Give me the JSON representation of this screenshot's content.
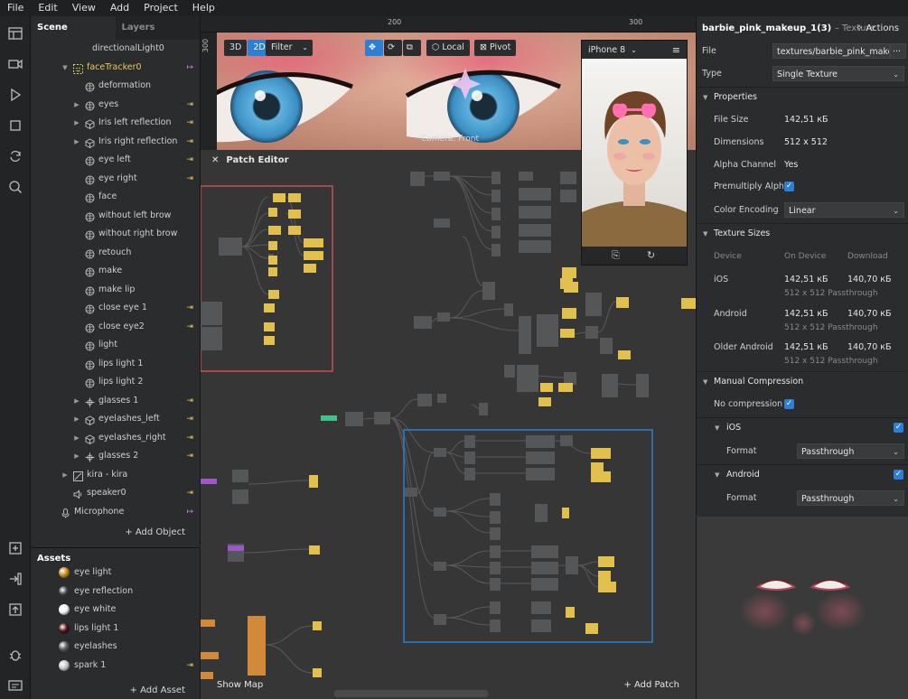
{
  "menu": [
    "File",
    "Edit",
    "View",
    "Add",
    "Project",
    "Help"
  ],
  "scene": {
    "tabs": [
      "Scene",
      "Layers"
    ],
    "items": [
      {
        "label": "directionalLight0",
        "indent": 0,
        "arrow": "",
        "icon": "none",
        "action": ""
      },
      {
        "label": "faceTracker0",
        "indent": 1,
        "arrow": "open",
        "icon": "face-tracker",
        "action": "out",
        "selected": true
      },
      {
        "label": "deformation",
        "indent": 2,
        "arrow": "",
        "icon": "mesh",
        "action": ""
      },
      {
        "label": "eyes",
        "indent": 2,
        "arrow": "closed",
        "icon": "mesh",
        "action": "in"
      },
      {
        "label": "Iris left  reflection",
        "indent": 2,
        "arrow": "closed",
        "icon": "cube",
        "action": "in"
      },
      {
        "label": "Iris right reflection",
        "indent": 2,
        "arrow": "closed",
        "icon": "cube",
        "action": "in"
      },
      {
        "label": "eye left",
        "indent": 2,
        "arrow": "",
        "icon": "mesh",
        "action": "in"
      },
      {
        "label": "eye right",
        "indent": 2,
        "arrow": "",
        "icon": "mesh",
        "action": "in"
      },
      {
        "label": "face",
        "indent": 2,
        "arrow": "",
        "icon": "mesh",
        "action": ""
      },
      {
        "label": "without left brow",
        "indent": 2,
        "arrow": "",
        "icon": "mesh",
        "action": ""
      },
      {
        "label": "without right brow",
        "indent": 2,
        "arrow": "",
        "icon": "mesh",
        "action": ""
      },
      {
        "label": "retouch",
        "indent": 2,
        "arrow": "",
        "icon": "mesh",
        "action": ""
      },
      {
        "label": "make",
        "indent": 2,
        "arrow": "",
        "icon": "mesh",
        "action": ""
      },
      {
        "label": "make lip",
        "indent": 2,
        "arrow": "",
        "icon": "mesh",
        "action": ""
      },
      {
        "label": "close eye 1",
        "indent": 2,
        "arrow": "",
        "icon": "mesh",
        "action": "in"
      },
      {
        "label": "close eye2",
        "indent": 2,
        "arrow": "",
        "icon": "mesh",
        "action": "in"
      },
      {
        "label": "light",
        "indent": 2,
        "arrow": "",
        "icon": "mesh",
        "action": ""
      },
      {
        "label": "lips light 1",
        "indent": 2,
        "arrow": "",
        "icon": "mesh",
        "action": ""
      },
      {
        "label": "lips light 2",
        "indent": 2,
        "arrow": "",
        "icon": "mesh",
        "action": ""
      },
      {
        "label": "glasses 1",
        "indent": 2,
        "arrow": "closed",
        "icon": "null-object",
        "action": "in"
      },
      {
        "label": "eyelashes_left",
        "indent": 2,
        "arrow": "closed",
        "icon": "cube",
        "action": "in"
      },
      {
        "label": "eyelashes_right",
        "indent": 2,
        "arrow": "closed",
        "icon": "cube",
        "action": "in"
      },
      {
        "label": "glasses 2",
        "indent": 2,
        "arrow": "closed",
        "icon": "null-object",
        "action": "in"
      },
      {
        "label": "kira - kira",
        "indent": 1,
        "arrow": "closed",
        "icon": "particle",
        "action": ""
      },
      {
        "label": "speaker0",
        "indent": 1,
        "arrow": "",
        "icon": "speaker",
        "action": "in"
      },
      {
        "label": "Microphone",
        "indent": 0,
        "arrow": "",
        "icon": "microphone",
        "action": "out-pink"
      }
    ],
    "add_object": "+ Add Object"
  },
  "assets": {
    "header": "Assets",
    "items": [
      {
        "label": "eye light",
        "color": "#c88a1c",
        "action": ""
      },
      {
        "label": "eye reflection",
        "color": "#3c3c3c",
        "action": ""
      },
      {
        "label": "eye white",
        "color": "#f2f2f2",
        "action": ""
      },
      {
        "label": "lips light 1",
        "color": "#4a1010",
        "action": ""
      },
      {
        "label": "eyelashes",
        "color": "#5a5a5a",
        "action": ""
      },
      {
        "label": "spark 1",
        "color": "#c8c8c8",
        "action": "in"
      }
    ],
    "add_asset": "+ Add Asset"
  },
  "viewport": {
    "ruler_h": [
      "200",
      "300"
    ],
    "ruler_v": "300",
    "mode_3d": "3D",
    "mode_2d": "2D",
    "filter": "Filter",
    "local": "Local",
    "pivot": "Pivot",
    "camera": "Camera: Front"
  },
  "preview": {
    "device": "iPhone 8"
  },
  "patch_editor": {
    "title": "Patch Editor",
    "show_map": "Show Map",
    "add_patch": "+ Add Patch"
  },
  "properties": {
    "title": "barbie_pink_makeup_1(3)",
    "subtitle": "– Texture",
    "actions": "Actions",
    "file_label": "File",
    "file_value": "textures/barbie_pink_make...",
    "file_more": "···",
    "type_label": "Type",
    "type_value": "Single Texture",
    "section_properties": "Properties",
    "file_size_label": "File Size",
    "file_size_value": "142,51 кБ",
    "dimensions_label": "Dimensions",
    "dimensions_value": "512 x 512",
    "alpha_label": "Alpha Channel",
    "alpha_value": "Yes",
    "premult_label": "Premultiply Alpha",
    "color_enc_label": "Color Encoding",
    "color_enc_value": "Linear",
    "section_sizes": "Texture Sizes",
    "col_device": "Device",
    "col_on_device": "On Device",
    "col_download": "Download",
    "sizes": [
      {
        "device": "iOS",
        "on_device": "142,51 кБ",
        "download": "140,70 кБ",
        "detail": "512 x 512 Passthrough"
      },
      {
        "device": "Android",
        "on_device": "142,51 кБ",
        "download": "140,70 кБ",
        "detail": "512 x 512 Passthrough"
      },
      {
        "device": "Older Android",
        "on_device": "142,51 кБ",
        "download": "140,70 кБ",
        "detail": "512 x 512 Passthrough"
      }
    ],
    "section_manual": "Manual Compression",
    "no_compression_label": "No compression",
    "ios_label": "iOS",
    "android_label": "Android",
    "format_label": "Format",
    "format_ios": "Passthrough",
    "format_android": "Passthrough"
  }
}
